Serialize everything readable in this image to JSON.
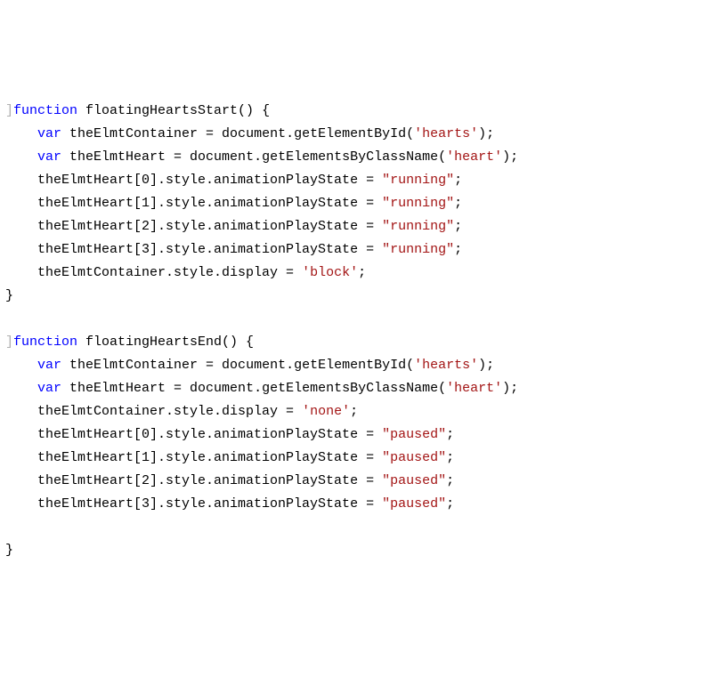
{
  "code": {
    "tokens": [
      [
        {
          "t": "]",
          "cls": "bracket-hint"
        },
        {
          "t": "function ",
          "cls": "kw"
        },
        {
          "t": "floatingHeartsStart() {",
          "cls": "fn"
        }
      ],
      [
        {
          "t": "    ",
          "cls": ""
        },
        {
          "t": "var ",
          "cls": "kw"
        },
        {
          "t": "theElmtContainer = document.getElementById(",
          "cls": "fn"
        },
        {
          "t": "'hearts'",
          "cls": "str"
        },
        {
          "t": ");",
          "cls": "fn"
        }
      ],
      [
        {
          "t": "    ",
          "cls": ""
        },
        {
          "t": "var ",
          "cls": "kw"
        },
        {
          "t": "theElmtHeart = document.getElementsByClassName(",
          "cls": "fn"
        },
        {
          "t": "'heart'",
          "cls": "str"
        },
        {
          "t": ");",
          "cls": "fn"
        }
      ],
      [
        {
          "t": "    theElmtHeart[0].style.animationPlayState = ",
          "cls": "fn"
        },
        {
          "t": "\"running\"",
          "cls": "str"
        },
        {
          "t": ";",
          "cls": "fn"
        }
      ],
      [
        {
          "t": "    theElmtHeart[1].style.animationPlayState = ",
          "cls": "fn"
        },
        {
          "t": "\"running\"",
          "cls": "str"
        },
        {
          "t": ";",
          "cls": "fn"
        }
      ],
      [
        {
          "t": "    theElmtHeart[2].style.animationPlayState = ",
          "cls": "fn"
        },
        {
          "t": "\"running\"",
          "cls": "str"
        },
        {
          "t": ";",
          "cls": "fn"
        }
      ],
      [
        {
          "t": "    theElmtHeart[3].style.animationPlayState = ",
          "cls": "fn"
        },
        {
          "t": "\"running\"",
          "cls": "str"
        },
        {
          "t": ";",
          "cls": "fn"
        }
      ],
      [
        {
          "t": "    theElmtContainer.style.display = ",
          "cls": "fn"
        },
        {
          "t": "'block'",
          "cls": "str"
        },
        {
          "t": ";",
          "cls": "fn"
        }
      ],
      [
        {
          "t": "}",
          "cls": "fn"
        }
      ],
      [
        {
          "t": "",
          "cls": ""
        }
      ],
      [
        {
          "t": "]",
          "cls": "bracket-hint"
        },
        {
          "t": "function ",
          "cls": "kw"
        },
        {
          "t": "floatingHeartsEnd() {",
          "cls": "fn"
        }
      ],
      [
        {
          "t": "    ",
          "cls": ""
        },
        {
          "t": "var ",
          "cls": "kw"
        },
        {
          "t": "theElmtContainer = document.getElementById(",
          "cls": "fn"
        },
        {
          "t": "'hearts'",
          "cls": "str"
        },
        {
          "t": ");",
          "cls": "fn"
        }
      ],
      [
        {
          "t": "    ",
          "cls": ""
        },
        {
          "t": "var ",
          "cls": "kw"
        },
        {
          "t": "theElmtHeart = document.getElementsByClassName(",
          "cls": "fn"
        },
        {
          "t": "'heart'",
          "cls": "str"
        },
        {
          "t": ");",
          "cls": "fn"
        }
      ],
      [
        {
          "t": "    theElmtContainer.style.display = ",
          "cls": "fn"
        },
        {
          "t": "'none'",
          "cls": "str"
        },
        {
          "t": ";",
          "cls": "fn"
        }
      ],
      [
        {
          "t": "    theElmtHeart[0].style.animationPlayState = ",
          "cls": "fn"
        },
        {
          "t": "\"paused\"",
          "cls": "str"
        },
        {
          "t": ";",
          "cls": "fn"
        }
      ],
      [
        {
          "t": "    theElmtHeart[1].style.animationPlayState = ",
          "cls": "fn"
        },
        {
          "t": "\"paused\"",
          "cls": "str"
        },
        {
          "t": ";",
          "cls": "fn"
        }
      ],
      [
        {
          "t": "    theElmtHeart[2].style.animationPlayState = ",
          "cls": "fn"
        },
        {
          "t": "\"paused\"",
          "cls": "str"
        },
        {
          "t": ";",
          "cls": "fn"
        }
      ],
      [
        {
          "t": "    theElmtHeart[3].style.animationPlayState = ",
          "cls": "fn"
        },
        {
          "t": "\"paused\"",
          "cls": "str"
        },
        {
          "t": ";",
          "cls": "fn"
        }
      ],
      [
        {
          "t": "",
          "cls": ""
        }
      ],
      [
        {
          "t": "}",
          "cls": "fn"
        }
      ]
    ]
  }
}
